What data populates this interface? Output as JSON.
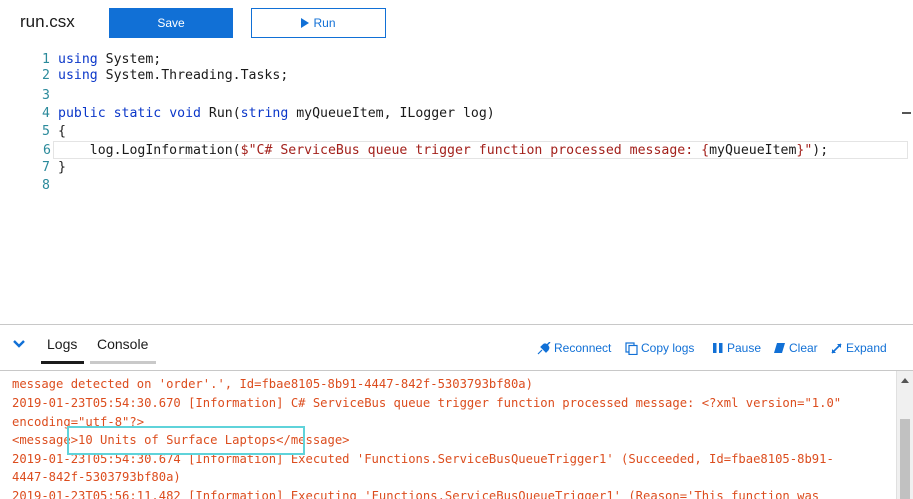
{
  "header": {
    "file_name": "run.csx",
    "save_label": "Save",
    "run_label": "Run"
  },
  "editor": {
    "lines": [
      {
        "num": "1",
        "parts": [
          {
            "t": "using",
            "c": "kw"
          },
          {
            "t": " System;",
            "c": ""
          }
        ]
      },
      {
        "num": "2",
        "parts": [
          {
            "t": "using",
            "c": "kw"
          },
          {
            "t": " System.Threading.Tasks;",
            "c": ""
          }
        ]
      },
      {
        "num": "3",
        "parts": []
      },
      {
        "num": "4",
        "parts": [
          {
            "t": "public",
            "c": "kw"
          },
          {
            "t": " ",
            "c": ""
          },
          {
            "t": "static",
            "c": "kw"
          },
          {
            "t": " ",
            "c": ""
          },
          {
            "t": "void",
            "c": "kw"
          },
          {
            "t": " Run(",
            "c": ""
          },
          {
            "t": "string",
            "c": "kw"
          },
          {
            "t": " myQueueItem, ILogger log)",
            "c": ""
          }
        ]
      },
      {
        "num": "5",
        "parts": [
          {
            "t": "{",
            "c": ""
          }
        ]
      },
      {
        "num": "6",
        "parts": [
          {
            "t": "    log.LogInformation(",
            "c": ""
          },
          {
            "t": "$\"C# ServiceBus queue trigger function processed message: {",
            "c": "str"
          },
          {
            "t": "myQueueItem",
            "c": ""
          },
          {
            "t": "}\"",
            "c": "str"
          },
          {
            "t": ");",
            "c": ""
          }
        ]
      },
      {
        "num": "7",
        "parts": [
          {
            "t": "}",
            "c": ""
          }
        ]
      },
      {
        "num": "8",
        "parts": []
      }
    ],
    "current_line": "6"
  },
  "panel": {
    "tabs": [
      {
        "label": "Logs",
        "active": true
      },
      {
        "label": "Console",
        "active": false
      }
    ],
    "actions": {
      "reconnect": "Reconnect",
      "copy_logs": "Copy logs",
      "pause": "Pause",
      "clear": "Clear",
      "expand": "Expand"
    },
    "log_lines": [
      "message detected on 'order'.', Id=fbae8105-8b91-4447-842f-5303793bf80a)",
      "2019-01-23T05:54:30.670 [Information] C# ServiceBus queue trigger function processed message: <?xml version=\"1.0\"",
      "encoding=\"utf-8\"?>",
      "<message>10 Units of Surface Laptops</message>",
      "2019-01-23T05:54:30.674 [Information] Executed 'Functions.ServiceBusQueueTrigger1' (Succeeded, Id=fbae8105-8b91-",
      "4447-842f-5303793bf80a)",
      "2019-01-23T05:56:11.482 [Information] Executing 'Functions.ServiceBusQueueTrigger1' (Reason='This function was"
    ]
  },
  "colors": {
    "accent": "#1170d6",
    "keyword": "#0b37c9",
    "string": "#a3211c",
    "log_text": "#dc4d1e",
    "line_number": "#2b8a9b",
    "highlight_box": "#5fd3da"
  }
}
